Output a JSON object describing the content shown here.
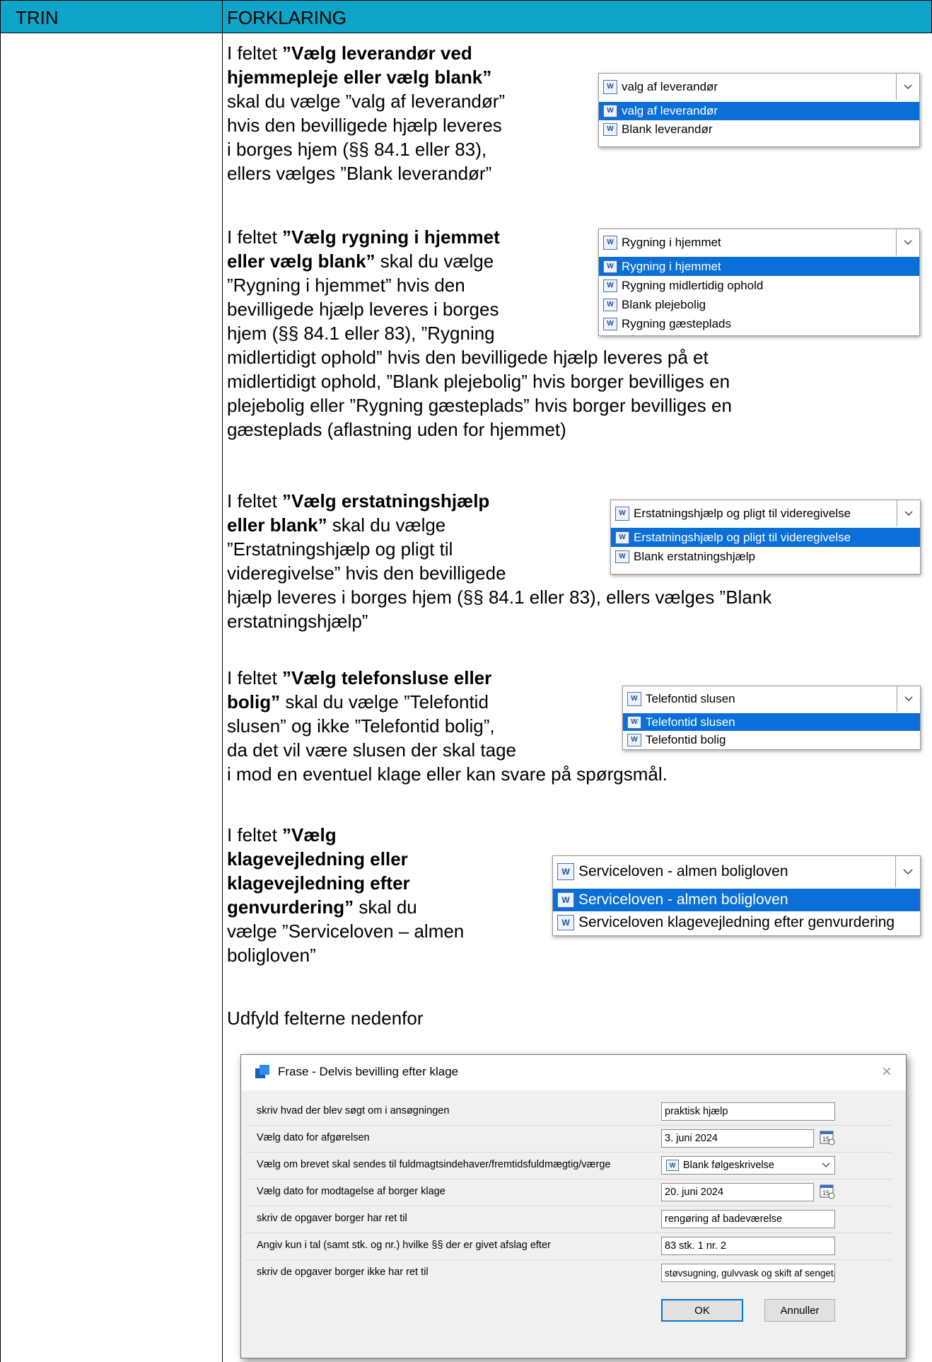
{
  "header": {
    "col1": "TRIN",
    "col2": "FORKLARING"
  },
  "sections": {
    "s1": {
      "lines": [
        "I feltet ",
        "”Vælg leverandør ved",
        "hjemmepleje eller vælg blank”",
        "skal du vælge ”valg af leverandør”",
        "hvis den bevilligede hjælp leveres",
        "i borges hjem (§§ 84.1 eller 83),",
        "ellers vælges ”Blank leverandør”"
      ],
      "dropdown": {
        "selected": "valg af leverandør",
        "options": [
          "valg af leverandør",
          "Blank leverandør"
        ]
      }
    },
    "s2": {
      "lines": [
        "I feltet ",
        "”Vælg rygning i hjemmet",
        "eller vælg blank”",
        " skal du vælge",
        "”Rygning i hjemmet” hvis den",
        "bevilligede hjælp leveres i borges",
        "hjem (§§ 84.1 eller 83), ”Rygning",
        "midlertidigt ophold” hvis den bevilligede hjælp leveres på et",
        "midlertidigt ophold, ”Blank plejebolig” hvis borger bevilliges en",
        "plejebolig eller ”Rygning gæsteplads” hvis borger bevilliges en",
        "gæsteplads (aflastning uden for hjemmet)"
      ],
      "dropdown": {
        "selected": "Rygning i hjemmet",
        "options": [
          "Rygning i hjemmet",
          "Rygning midlertidig ophold",
          "Blank plejebolig",
          "Rygning gæsteplads"
        ]
      }
    },
    "s3": {
      "lines": [
        "I feltet ",
        "”Vælg erstatningshjælp",
        "eller blank”",
        " skal du vælge",
        "”Erstatningshjælp og pligt til",
        "videregivelse” hvis den bevilligede",
        "hjælp leveres i borges hjem (§§ 84.1 eller 83), ellers vælges ”Blank",
        "erstatningshjælp”"
      ],
      "dropdown": {
        "selected": "Erstatningshjælp og pligt til videregivelse",
        "options": [
          "Erstatningshjælp og pligt til videregivelse",
          "Blank erstatningshjælp"
        ]
      }
    },
    "s4": {
      "lines": [
        "I feltet ",
        "”Vælg telefonsluse eller",
        "bolig”",
        " skal du vælge ”Telefontid",
        "slusen” og ikke ”Telefontid bolig”,",
        "da det vil være slusen der skal tage",
        "i mod en eventuel klage eller kan svare på spørgsmål."
      ],
      "dropdown": {
        "selected": "Telefontid slusen",
        "options": [
          "Telefontid slusen",
          "Telefontid bolig"
        ]
      }
    },
    "s5": {
      "lines": [
        "I feltet ",
        "”Vælg",
        "klagevejledning eller",
        "klagevejledning efter",
        "genvurdering”",
        " skal du",
        "vælge ”Serviceloven – almen",
        "boligloven”"
      ],
      "dropdown": {
        "selected": "Serviceloven - almen boligloven",
        "options": [
          "Serviceloven - almen boligloven",
          "Serviceloven klagevejledning efter genvurdering"
        ]
      }
    },
    "s6": {
      "text": "Udfyld felterne nedenfor"
    }
  },
  "dialog": {
    "title": "Frase - Delvis bevilling efter klage",
    "close": "×",
    "fields": [
      {
        "label": "skriv hvad der blev søgt om i ansøgningen",
        "value": "praktisk hjælp"
      },
      {
        "label": "Vælg dato for afgørelsen",
        "value": "3. juni 2024"
      },
      {
        "label": "Vælg om brevet skal sendes til fuldmagtsindehaver/fremtidsfuldmægtig/værge",
        "value": "Blank følgeskrivelse"
      },
      {
        "label": "Vælg dato for modtagelse af borger klage",
        "value": "20. juni 2024"
      },
      {
        "label": "skriv de opgaver borger har ret til",
        "value": "rengøring af badeværelse"
      },
      {
        "label": "Angiv kun i tal (samt stk. og nr.) hvilke §§ der er givet afslag efter",
        "value": "83 stk. 1 nr. 2"
      },
      {
        "label": "skriv de opgaver borger ikke har ret til",
        "value": "støvsugning, gulvvask og skift af sengetøj"
      }
    ],
    "ok": "OK",
    "cancel": "Annuller"
  },
  "icons": {
    "doc": "word-doc-icon",
    "calendar": "calendar-icon",
    "arrow": "chevron-down-icon"
  },
  "colors": {
    "header": "#0ea5c9",
    "selection": "#0a6fd6"
  }
}
